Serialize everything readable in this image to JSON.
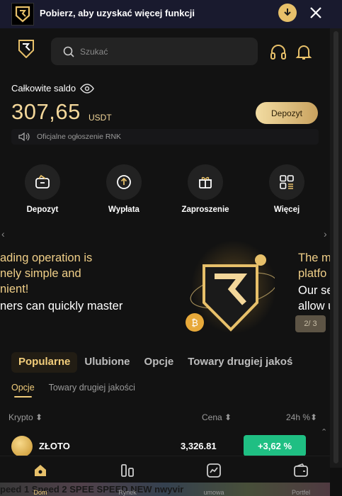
{
  "topbar": {
    "text": "Pobierz, aby uzyskać więcej funkcji"
  },
  "search": {
    "placeholder": "Szukać"
  },
  "balance": {
    "label": "Całkowite saldo",
    "value": "307,65",
    "currency": "USDT",
    "deposit_label": "Depozyt"
  },
  "notice": {
    "text": "Oficjalne ogłoszenie RNK"
  },
  "actions": [
    {
      "label": "Depozyt",
      "icon": "wallet-icon"
    },
    {
      "label": "Wypłata",
      "icon": "withdraw-icon"
    },
    {
      "label": "Zaproszenie",
      "icon": "gift-icon"
    },
    {
      "label": "Więcej",
      "icon": "grid-icon"
    }
  ],
  "banner": {
    "left_lines": [
      "ading operation is",
      "nely simple and",
      "nient!",
      "ners can quickly master"
    ],
    "right_lines": [
      "The m",
      "platfo",
      "Our se",
      "allow u"
    ],
    "pager": "2/ 3"
  },
  "tabs": [
    "Popularne",
    "Ulubione",
    "Opcje",
    "Towary drugiej jakoś"
  ],
  "subtabs": [
    "Opcje",
    "Towary drugiej jakości"
  ],
  "table": {
    "headers": {
      "crypto": "Krypto",
      "price": "Cena",
      "change": "24h %"
    },
    "rows": [
      {
        "name": "ZŁOTO",
        "price": "3,326.81",
        "change": "+3,62 %"
      }
    ]
  },
  "ticker": "peed 1 Speed 2  SPEE   SPEED NEW  nwyvir",
  "nav": [
    {
      "label": "Dom",
      "icon": "home-icon"
    },
    {
      "label": "Rynek",
      "icon": "market-icon"
    },
    {
      "label": "umowa",
      "icon": "chart-icon"
    },
    {
      "label": "Portfel",
      "icon": "wallet-icon"
    }
  ],
  "colors": {
    "accent": "#f2cd7b",
    "up": "#1fbf83",
    "bg": "#121212"
  }
}
